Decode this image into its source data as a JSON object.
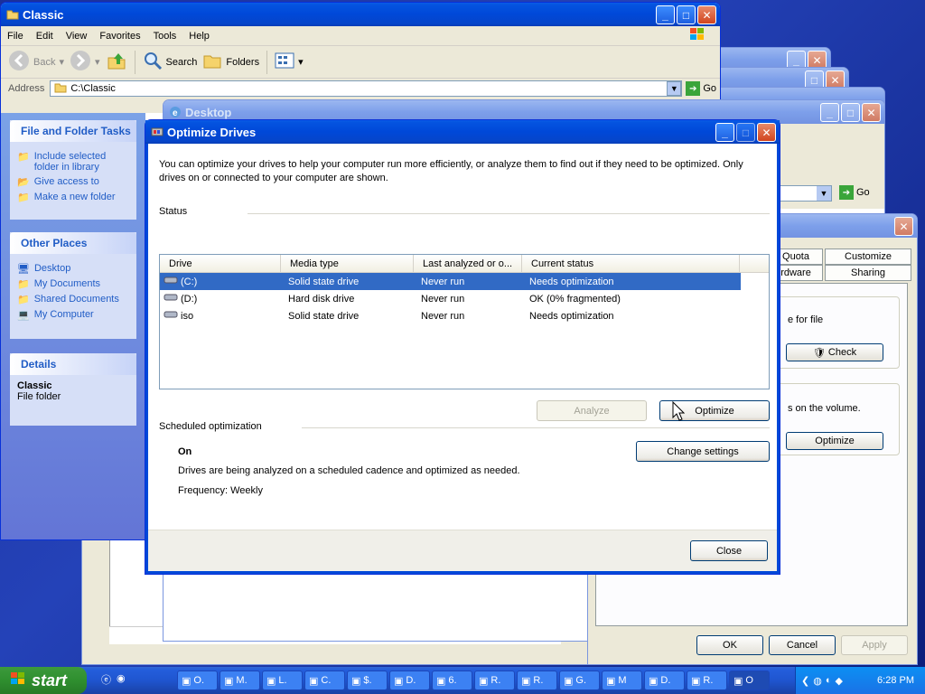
{
  "explorer": {
    "title": "Classic",
    "menu": [
      "File",
      "Edit",
      "View",
      "Favorites",
      "Tools",
      "Help"
    ],
    "toolbar": {
      "back": "Back",
      "search": "Search",
      "folders": "Folders"
    },
    "address_label": "Address",
    "address_value": "C:\\Classic",
    "go_label": "Go",
    "file_tasks": {
      "title": "File and Folder Tasks",
      "items": [
        "Include selected folder in library",
        "Give access to",
        "Make a new folder"
      ]
    },
    "other_places": {
      "title": "Other Places",
      "items": [
        "Desktop",
        "My Documents",
        "Shared Documents",
        "My Computer"
      ]
    },
    "details": {
      "title": "Details",
      "name": "Classic",
      "type": "File folder"
    }
  },
  "desktop_window": {
    "title": "Desktop",
    "go_label": "Go"
  },
  "properties": {
    "tabs": [
      "Quota",
      "Customize",
      "rdware",
      "Sharing"
    ],
    "check_text": "e for file",
    "check_button": "Check",
    "optimize_text": "s on the volume.",
    "optimize_button": "Optimize",
    "ok": "OK",
    "cancel": "Cancel",
    "apply": "Apply"
  },
  "dialog": {
    "title": "Optimize Drives",
    "intro": "You can optimize your drives to help your computer run more efficiently, or analyze them to find out if they need to be optimized. Only drives on or connected to your computer are shown.",
    "status_label": "Status",
    "columns": [
      "Drive",
      "Media type",
      "Last analyzed or o...",
      "Current status"
    ],
    "drives": [
      {
        "drive": "(C:)",
        "media": "Solid state drive",
        "last": "Never run",
        "status": "Needs optimization"
      },
      {
        "drive": "(D:)",
        "media": "Hard disk drive",
        "last": "Never run",
        "status": "OK (0% fragmented)"
      },
      {
        "drive": "iso",
        "media": "Solid state drive",
        "last": "Never run",
        "status": "Needs optimization"
      }
    ],
    "analyze": "Analyze",
    "optimize": "Optimize",
    "scheduled_label": "Scheduled optimization",
    "sched_state": "On",
    "change_settings": "Change settings",
    "sched_desc": "Drives are being analyzed on a scheduled cadence and optimized as needed.",
    "frequency": "Frequency: Weekly",
    "close": "Close"
  },
  "taskbar": {
    "start": "start",
    "tasks": [
      "O.",
      "M.",
      "L.",
      "C.",
      "$.",
      "D.",
      "6.",
      "R.",
      "R.",
      "G.",
      "M",
      "D.",
      "R.",
      "O"
    ],
    "clock": "6:28 PM"
  }
}
